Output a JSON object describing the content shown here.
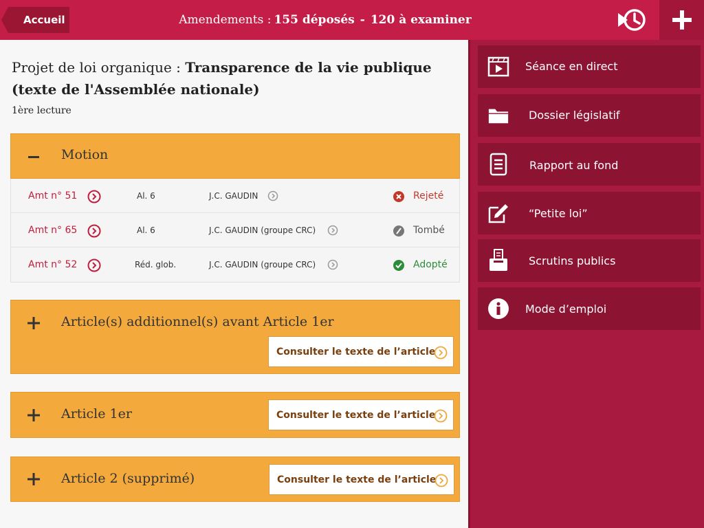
{
  "header": {
    "back_label": "Accueil",
    "title_prefix": "Amendements :",
    "deposited": "155 déposés",
    "separator": "-",
    "to_examine": "120 à examiner",
    "brand_color": "#c41e48"
  },
  "document": {
    "title_prefix": "Projet de loi organique :",
    "title_bold": "Transparence de la vie publique (texte de l'Assemblée nationale)",
    "reading": "1ère lecture"
  },
  "sections": [
    {
      "toggle": "minus",
      "title": "Motion",
      "expanded": true
    },
    {
      "toggle": "plus",
      "title": "Article(s) additionnel(s) avant Article 1er",
      "consult_label": "Consulter le texte de l’article"
    },
    {
      "toggle": "plus",
      "title": "Article 1er",
      "consult_label": "Consulter le texte de l’article"
    },
    {
      "toggle": "plus",
      "title": "Article 2 (supprimé)",
      "consult_label": "Consulter le texte de l’article"
    }
  ],
  "amendments": [
    {
      "number": "Amt n° 51",
      "alinea": "Al. 6",
      "author": "J.C. GAUDIN",
      "status": "Rejeté",
      "status_type": "rejected",
      "status_color": "#c0392b"
    },
    {
      "number": "Amt n° 65",
      "alinea": "Al. 6",
      "author": "J.C. GAUDIN (groupe CRC)",
      "status": "Tombé",
      "status_type": "fallen",
      "status_color": "#555555"
    },
    {
      "number": "Amt n° 52",
      "alinea": "Réd. glob.",
      "author": "J.C. GAUDIN (groupe CRC)",
      "status": "Adopté",
      "status_type": "adopted",
      "status_color": "#2e8b3a"
    }
  ],
  "sidebar": {
    "items": [
      {
        "label": "Séance en direct",
        "icon": "video-play-icon"
      },
      {
        "label": "Dossier législatif",
        "icon": "folder-icon"
      },
      {
        "label": "Rapport au fond",
        "icon": "document-icon"
      },
      {
        "label": "“Petite loi”",
        "icon": "edit-icon"
      },
      {
        "label": "Scrutins publics",
        "icon": "ballot-box-icon"
      },
      {
        "label": "Mode d’emploi",
        "icon": "info-icon"
      }
    ]
  }
}
